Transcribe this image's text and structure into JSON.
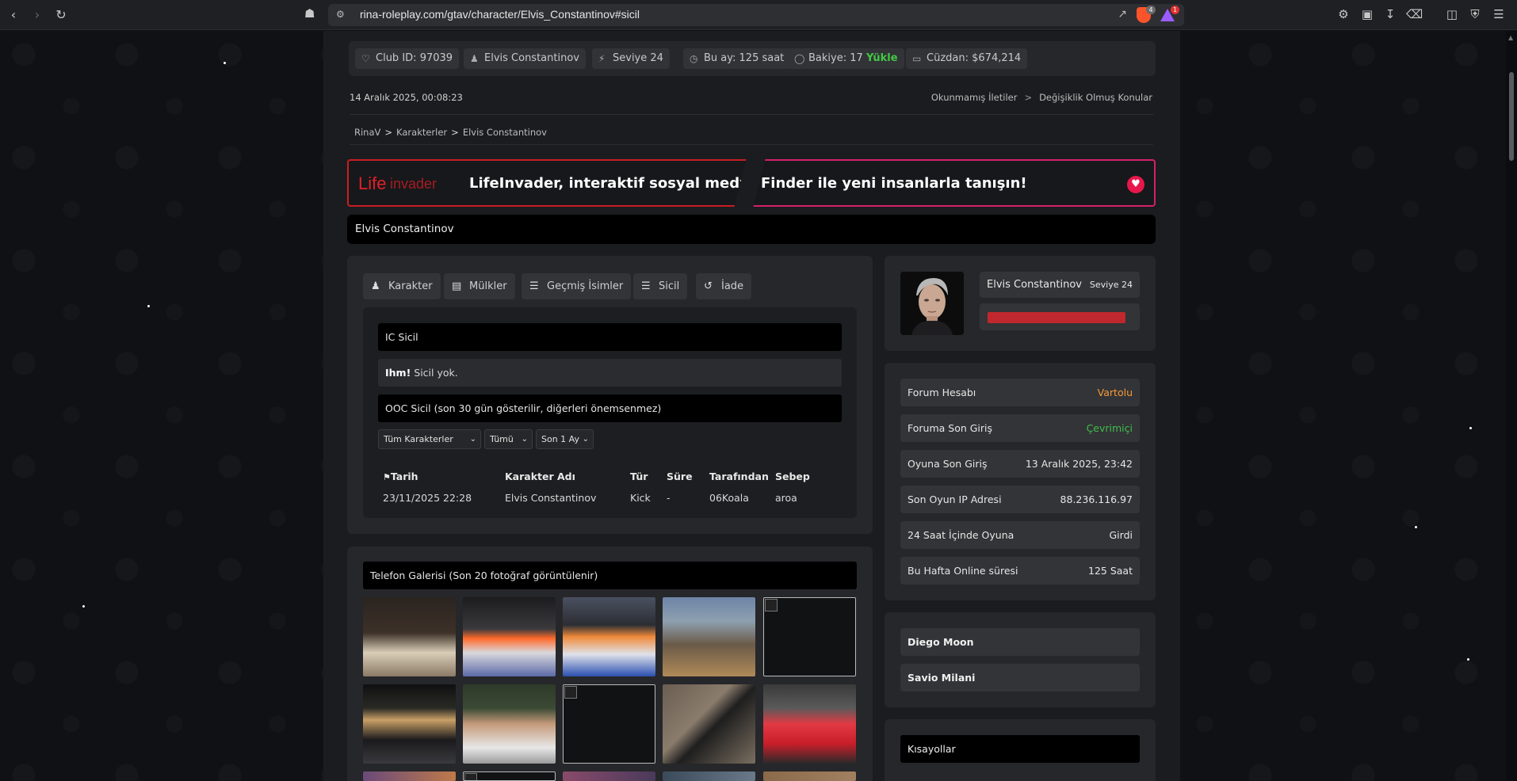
{
  "browser": {
    "url": "rina-roleplay.com/gtav/character/Elvis_Constantinov#sicil",
    "shield_count": "4",
    "rewards_count": "1"
  },
  "stats": {
    "club_label": "Club ID:",
    "club_id": "97039",
    "username": "Elvis Constantinov",
    "level_label": "Seviye",
    "level": "24",
    "month_label": "Bu ay:",
    "month_value": "125 saat",
    "balance_label": "Bakiye:",
    "balance_value": "17",
    "topup": "Yükle",
    "wallet_label": "Cüzdan:",
    "wallet_value": "$674,214"
  },
  "datetime": "14 Aralık 2025, 00:08:23",
  "toplinks": {
    "unread": "Okunmamış İletiler",
    "sep": ">",
    "changed": "Değişiklik Olmuş Konular"
  },
  "breadcrumbs": [
    "RinaV",
    "Karakterler",
    "Elvis Constantinov"
  ],
  "banner": {
    "logo_life": "Life",
    "logo_invader": "invader",
    "text_left": "LifeInvader, interaktif sosyal medya!",
    "text_right": "Finder ile yeni insanlarla tanışın!"
  },
  "character_name": "Elvis Constantinov",
  "tabs": [
    {
      "label": "Karakter",
      "icon": "person-icon"
    },
    {
      "label": "Mülkler",
      "icon": "building-icon"
    },
    {
      "label": "Geçmiş İsimler",
      "icon": "list-icon"
    },
    {
      "label": "Sicil",
      "icon": "list-icon"
    },
    {
      "label": "İade",
      "icon": "undo-icon"
    }
  ],
  "sicil": {
    "ic_title": "IC Sicil",
    "empty_bold": "Ihm!",
    "empty_text": "Sicil yok.",
    "ooc_title": "OOC Sicil (son 30 gün gösterilir, diğerleri önemsenmez)",
    "filter_character": "Tüm Karakterler",
    "filter_type": "Tümü",
    "filter_period": "Son 1 Ay",
    "columns": [
      "Tarih",
      "Karakter Adı",
      "Tür",
      "Süre",
      "Tarafından",
      "Sebep"
    ],
    "rows": [
      [
        "23/11/2025 22:28",
        "Elvis Constantinov",
        "Kick",
        "-",
        "06Koala",
        "aroa"
      ]
    ]
  },
  "gallery": {
    "title": "Telefon Galerisi (Son 20 fotoğraf görüntülenir)"
  },
  "profile": {
    "name": "Elvis Constantinov",
    "level": "Seviye 24"
  },
  "info": [
    {
      "key": "Forum Hesabı",
      "value": "Vartolu"
    },
    {
      "key": "Foruma Son Giriş",
      "value": "Çevrimiçi"
    },
    {
      "key": "Oyuna Son Giriş",
      "value": "13 Aralık 2025, 23:42"
    },
    {
      "key": "Son Oyun IP Adresi",
      "value": "88.236.116.97"
    },
    {
      "key": "24 Saat İçinde Oyuna",
      "value": "Girdi"
    },
    {
      "key": "Bu Hafta Online süresi",
      "value": "125 Saat"
    }
  ],
  "other_characters": [
    "Diego Moon",
    "Savio Milani"
  ],
  "shortcuts_title": "Kısayollar",
  "colors": {
    "accent_red": "#c91d22",
    "accent_pink": "#d41f6a",
    "orange": "#f59a3b",
    "online_green": "#3fbf4a"
  }
}
